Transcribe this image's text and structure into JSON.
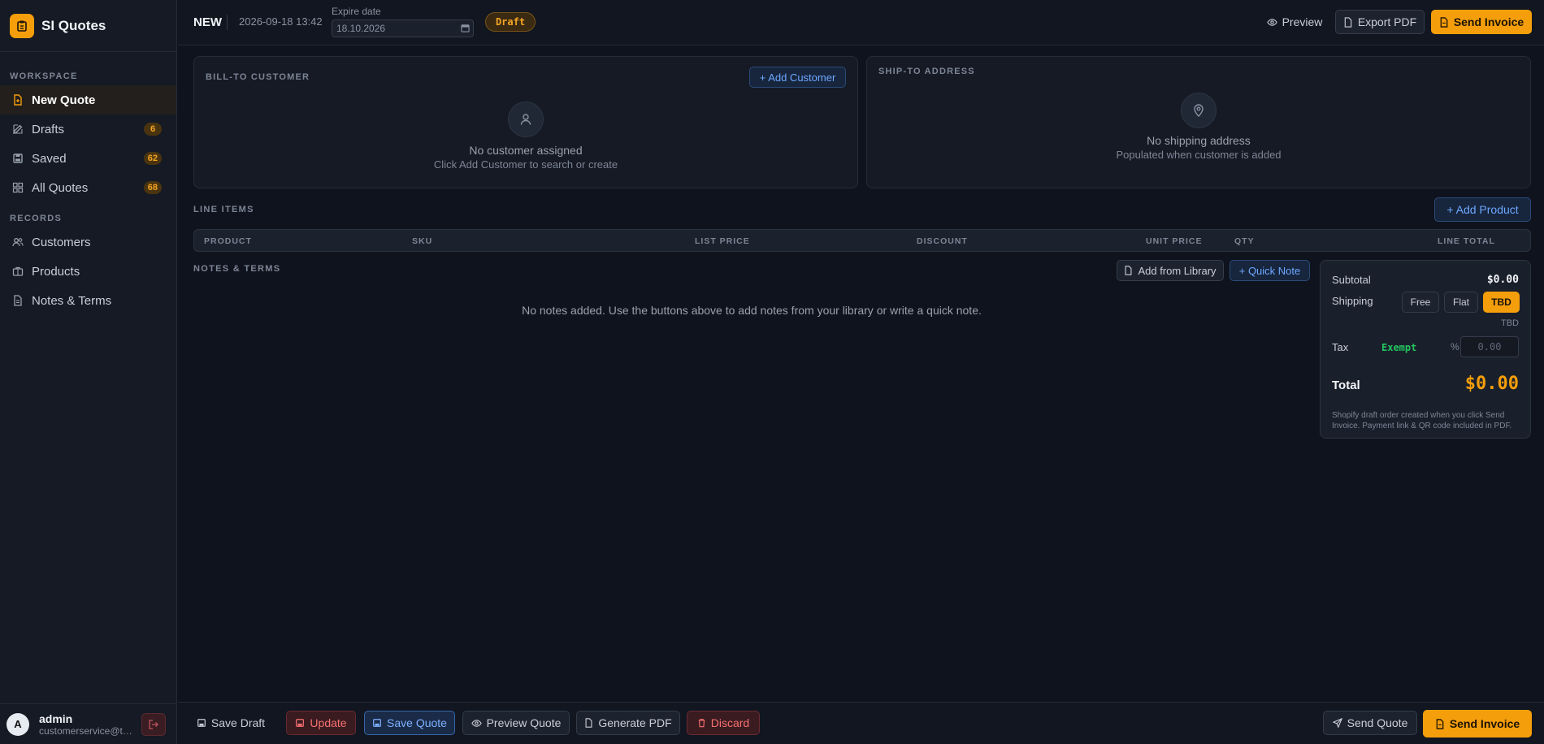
{
  "app": {
    "name": "SI Quotes"
  },
  "sidebar": {
    "workspace_label": "WORKSPACE",
    "records_label": "RECORDS",
    "workspace_items": [
      {
        "label": "New Quote",
        "badge": "",
        "icon": "file-plus-icon",
        "active": true
      },
      {
        "label": "Drafts",
        "badge": "6",
        "icon": "edit-icon"
      },
      {
        "label": "Saved",
        "badge": "62",
        "icon": "save-icon"
      },
      {
        "label": "All Quotes",
        "badge": "68",
        "icon": "grid-icon"
      }
    ],
    "records_items": [
      {
        "label": "Customers",
        "icon": "users-icon"
      },
      {
        "label": "Products",
        "icon": "briefcase-icon"
      },
      {
        "label": "Notes & Terms",
        "icon": "document-icon"
      }
    ]
  },
  "user": {
    "initial": "A",
    "name": "admin",
    "email": "customerservice@to..."
  },
  "topbar": {
    "status": "NEW",
    "created": "2026-09-18 13:42",
    "expire_label": "Expire date",
    "expire_value": "18.10.2026",
    "draft_badge": "Draft",
    "preview": "Preview",
    "export_pdf": "Export PDF",
    "send_invoice": "Send Invoice"
  },
  "bill_to": {
    "title": "BILL-TO CUSTOMER",
    "add_button": "+ Add Customer",
    "empty_main": "No customer assigned",
    "empty_sub": "Click Add Customer to search or create"
  },
  "ship_to": {
    "title": "SHIP-TO ADDRESS",
    "empty_main": "No shipping address",
    "empty_sub": "Populated when customer is added"
  },
  "line_items": {
    "title": "LINE ITEMS",
    "add_button": "+ Add Product",
    "columns": [
      "PRODUCT",
      "SKU",
      "LIST PRICE",
      "DISCOUNT",
      "UNIT PRICE",
      "QTY",
      "LINE TOTAL"
    ]
  },
  "notes": {
    "title": "NOTES & TERMS",
    "add_from_library": "Add from Library",
    "quick_note": "+ Quick Note",
    "empty": "No notes added. Use the buttons above to add notes from your library or write a quick note."
  },
  "summary": {
    "subtotal_label": "Subtotal",
    "subtotal_value": "$0.00",
    "shipping_label": "Shipping",
    "shipping_options": [
      "Free",
      "Flat",
      "TBD"
    ],
    "shipping_selected": "TBD",
    "shipping_value": "TBD",
    "tax_label": "Tax",
    "tax_status": "Exempt",
    "tax_unit": "%",
    "tax_placeholder": "0.00",
    "total_label": "Total",
    "total_value": "$0.00",
    "note": "Shopify draft order created when you click Send Invoice. Payment link & QR code included in PDF."
  },
  "bottombar": {
    "save_draft": "Save Draft",
    "update": "Update",
    "save_quote": "Save Quote",
    "preview_quote": "Preview Quote",
    "generate_pdf": "Generate PDF",
    "discard": "Discard",
    "send_quote": "Send Quote",
    "send_invoice": "Send Invoice"
  },
  "colors": {
    "accent": "#f59e0b",
    "background": "#0f131d",
    "panel": "#151a24",
    "link": "#6ea8ff",
    "danger": "#f87171",
    "success": "#22c55e"
  }
}
